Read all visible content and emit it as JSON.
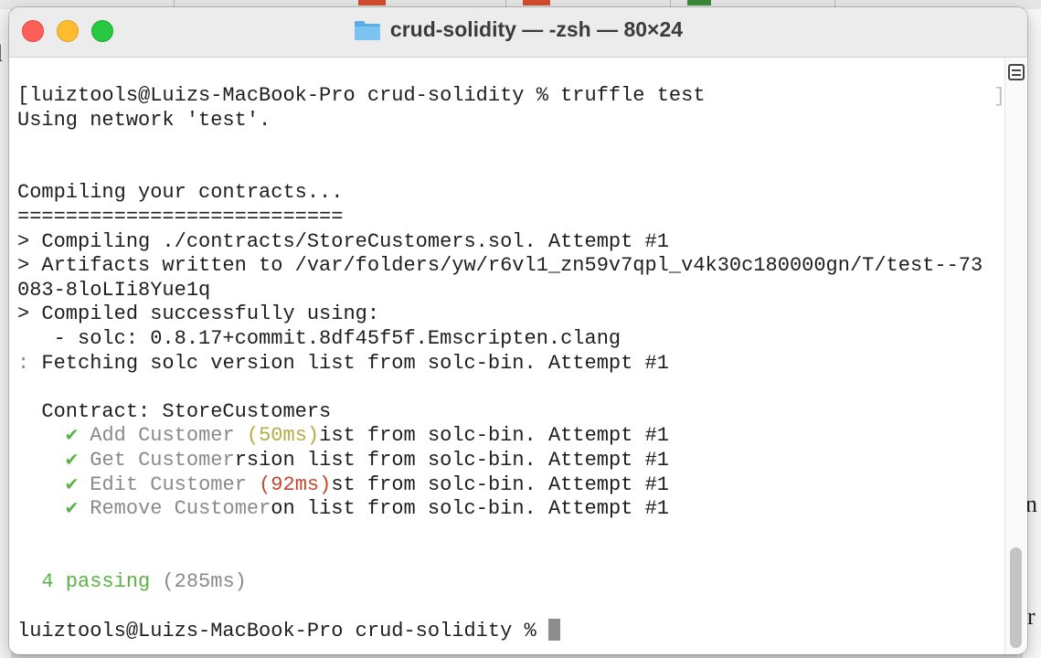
{
  "window": {
    "title": "crud-solidity — -zsh — 80×24",
    "folder_icon": "folder-icon"
  },
  "terminal": {
    "lines": [
      [
        {
          "t": "[luiztools@Luizs-MacBook-Pro crud-solidity % truffle test"
        }
      ],
      [
        {
          "t": "Using network 'test'."
        }
      ],
      [
        {
          "t": ""
        }
      ],
      [
        {
          "t": ""
        }
      ],
      [
        {
          "t": "Compiling your contracts..."
        }
      ],
      [
        {
          "t": "==========================="
        }
      ],
      [
        {
          "t": "> Compiling ./contracts/StoreCustomers.sol. Attempt #1"
        }
      ],
      [
        {
          "t": "> Artifacts written to /var/folders/yw/r6vl1_zn59v7qpl_v4k30c180000gn/T/test--73"
        }
      ],
      [
        {
          "t": "083-8loLIi8Yue1q"
        }
      ],
      [
        {
          "t": "> Compiled successfully using:"
        }
      ],
      [
        {
          "t": "   - solc: 0.8.17+commit.8df45f5f.Emscripten.clang"
        }
      ],
      [
        {
          "t": ": ",
          "c": "gray"
        },
        {
          "t": "Fetching solc version list from solc-bin. Attempt #1"
        }
      ],
      [
        {
          "t": ""
        }
      ],
      [
        {
          "t": "  Contract: StoreCustomers"
        }
      ],
      [
        {
          "t": "    "
        },
        {
          "t": "✔",
          "c": "green"
        },
        {
          "t": " Add Customer ",
          "c": "gray"
        },
        {
          "t": "(50ms)",
          "c": "olive"
        },
        {
          "t": "ist from solc-bin. Attempt #1"
        }
      ],
      [
        {
          "t": "    "
        },
        {
          "t": "✔",
          "c": "green"
        },
        {
          "t": " Get Customer",
          "c": "gray"
        },
        {
          "t": "rsion list from solc-bin. Attempt #1"
        }
      ],
      [
        {
          "t": "    "
        },
        {
          "t": "✔",
          "c": "green"
        },
        {
          "t": " Edit Customer ",
          "c": "gray"
        },
        {
          "t": "(92ms)",
          "c": "red"
        },
        {
          "t": "st from solc-bin. Attempt #1"
        }
      ],
      [
        {
          "t": "    "
        },
        {
          "t": "✔",
          "c": "green"
        },
        {
          "t": " Remove Customer",
          "c": "gray"
        },
        {
          "t": "on list from solc-bin. Attempt #1"
        }
      ],
      [
        {
          "t": ""
        }
      ],
      [
        {
          "t": ""
        }
      ],
      [
        {
          "t": "  "
        },
        {
          "t": "4 passing",
          "c": "green"
        },
        {
          "t": " (285ms)",
          "c": "gray"
        }
      ],
      [
        {
          "t": ""
        }
      ],
      [
        {
          "t": "luiztools@Luizs-MacBook-Pro crud-solidity % "
        },
        {
          "cursor": true
        }
      ]
    ],
    "right_bracket": "]"
  },
  "colors": {
    "green": "#5ab246",
    "gray": "#8a8a8a",
    "olive": "#b4ad46",
    "red": "#c0492f"
  },
  "background": {
    "left_glyph": "l",
    "right_glyph_1": "n",
    "right_glyph_2": "r"
  }
}
